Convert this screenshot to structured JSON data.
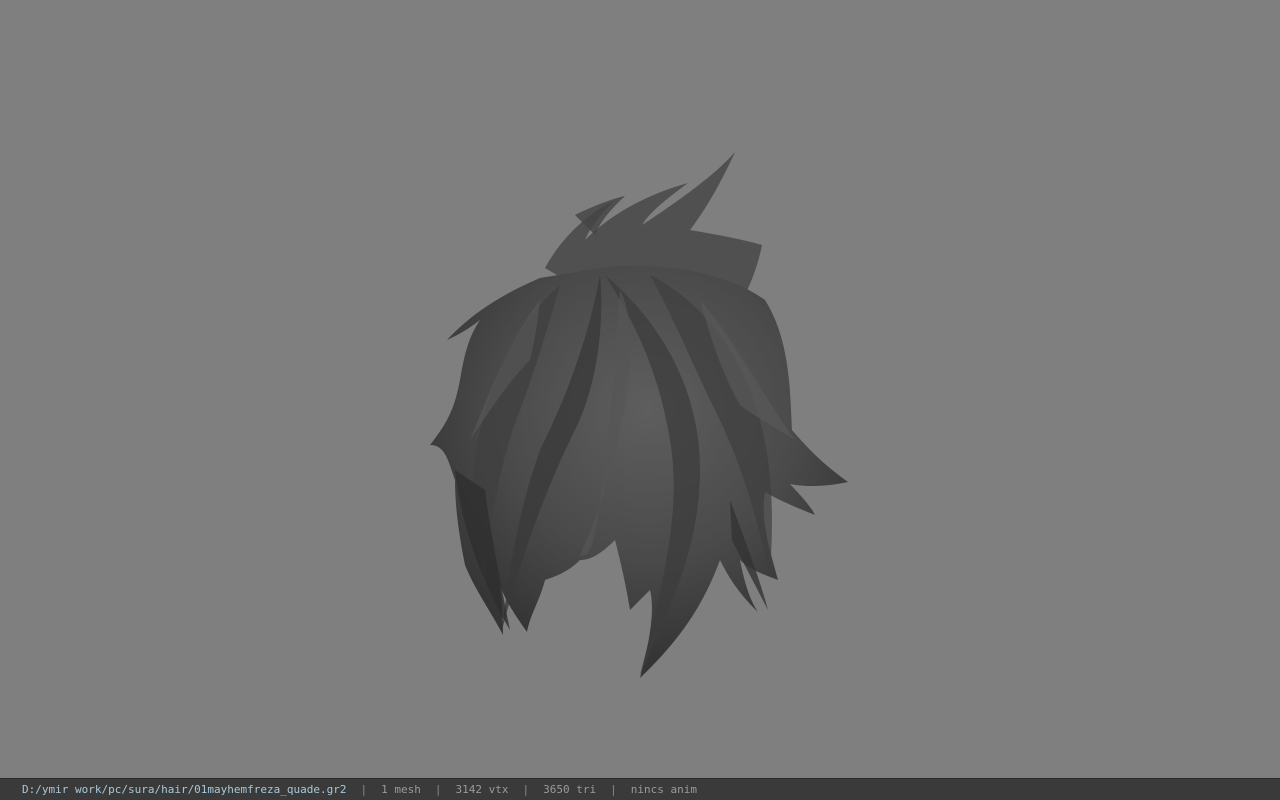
{
  "viewport": {
    "background_color": "#7f7f7f",
    "model": {
      "kind": "hair-mesh",
      "shade_dark": "#2e2e2e",
      "shade_mid": "#4a4a4a",
      "shade_light": "#5c5c5c"
    }
  },
  "status_bar": {
    "file_path": "D:/ymir work/pc/sura/hair/01mayhemfreza_quade.gr2",
    "separator": "|",
    "mesh_count": "1 mesh",
    "vertex_count": "3142 vtx",
    "triangle_count": "3650 tri",
    "anim_info": "nincs anim",
    "path_color": "#a8c8d8",
    "background_color": "#3a3a3a"
  }
}
